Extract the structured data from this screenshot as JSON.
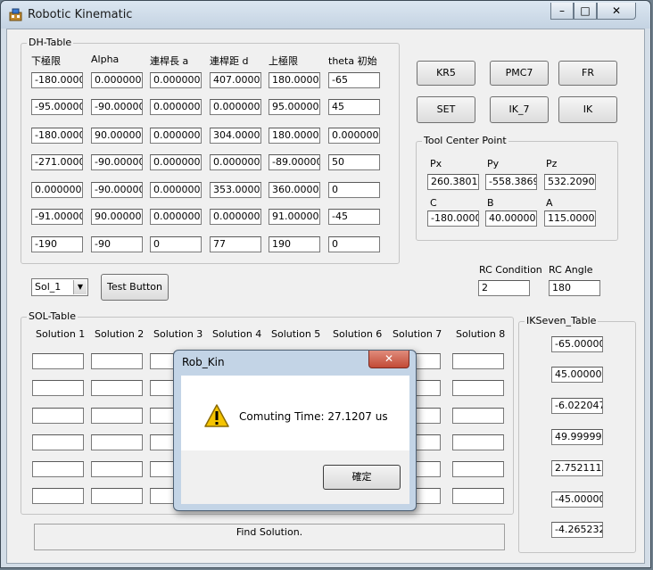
{
  "window": {
    "title": "Robotic Kinematic",
    "minimize": "–",
    "maximize": "□",
    "close": "✕"
  },
  "dh": {
    "legend": "DH-Table",
    "headers": [
      "下極限",
      "Alpha",
      "連桿長 a",
      "連桿距 d",
      "上極限",
      "theta 初始"
    ],
    "rows": [
      [
        "-180.00000",
        "0.000000",
        "0.000000",
        "407.000000",
        "180.000000",
        "-65"
      ],
      [
        "-95.000000",
        "-90.000000",
        "0.000000",
        "0.000000",
        "95.000000",
        "45"
      ],
      [
        "-180.00000",
        "90.000000",
        "0.000000",
        "304.000000",
        "180.000000",
        "0.000000"
      ],
      [
        "-271.00000",
        "-90.000000",
        "0.000000",
        "0.000000",
        "-89.000000",
        "50"
      ],
      [
        "0.000000",
        "-90.000000",
        "0.000000",
        "353.000000",
        "360.000000",
        "0"
      ],
      [
        "-91.000000",
        "90.000000",
        "0.000000",
        "0.000000",
        "91.000000",
        "-45"
      ],
      [
        "-190",
        "-90",
        "0",
        "77",
        "190",
        "0"
      ]
    ]
  },
  "buttons": {
    "kr5": "KR5",
    "pmc7": "PMC7",
    "fr": "FR",
    "set": "SET",
    "ik7": "IK_7",
    "ik": "IK",
    "test": "Test Button"
  },
  "tcp": {
    "legend": "Tool Center Point",
    "labels1": [
      "Px",
      "Py",
      "Pz"
    ],
    "values1": [
      "260.38011",
      "-558.38695",
      "532.20906"
    ],
    "labels2": [
      "C",
      "B",
      "A"
    ],
    "values2": [
      "-180.00000",
      "40.000000",
      "115.000000"
    ]
  },
  "rc": {
    "condition_label": "RC Condition",
    "condition_value": "2",
    "angle_label": "RC Angle",
    "angle_value": "180"
  },
  "combo": {
    "value": "Sol_1",
    "arrow": "▼"
  },
  "sol": {
    "legend": "SOL-Table",
    "headers": [
      "Solution 1",
      "Solution 2",
      "Solution 3",
      "Solution 4",
      "Solution 5",
      "Solution 6",
      "Solution 7",
      "Solution 8"
    ]
  },
  "ikseven": {
    "legend": "IKSeven_Table",
    "values": [
      "-65.000000",
      "45.000000",
      "-6.0220472",
      "49.999999",
      "2.7521110",
      "-45.000000",
      "-4.2652322"
    ]
  },
  "status": "Find Solution.",
  "dialog": {
    "title": "Rob_Kin",
    "close": "✕",
    "message": "Comuting Time: 27.1207 us",
    "ok": "確定"
  },
  "colors": {
    "warning_fill": "#f5c400",
    "close_red": "#c24a36"
  },
  "icons": {
    "app": "robot-app-icon",
    "warning": "warning-icon"
  }
}
